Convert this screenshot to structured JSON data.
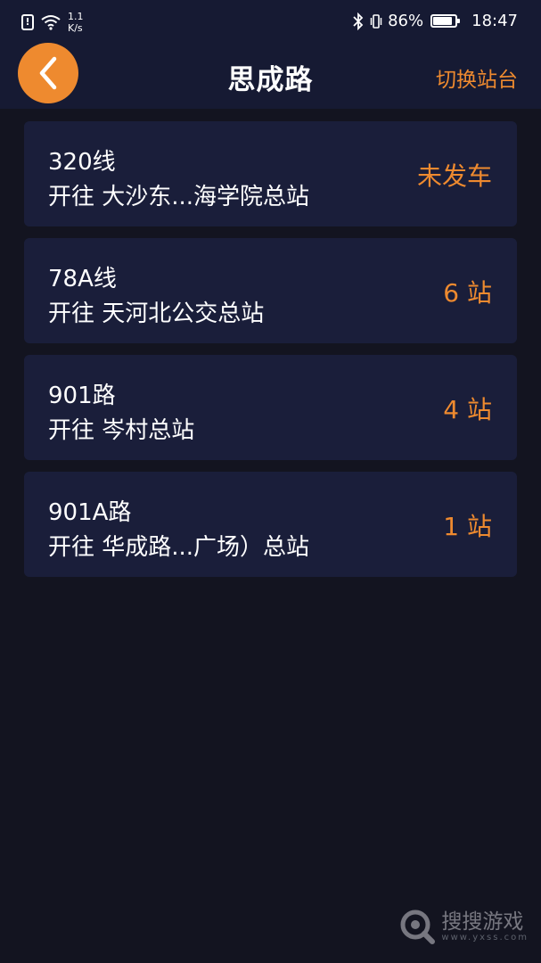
{
  "status_bar": {
    "net_speed_value": "1.1",
    "net_speed_unit": "K/s",
    "battery": "86%",
    "time": "18:47"
  },
  "header": {
    "title": "思成路",
    "switch_label": "切换站台"
  },
  "routes": [
    {
      "name": "320线",
      "dest": "开往 大沙东...海学院总站",
      "status": "未发车"
    },
    {
      "name": "78A线",
      "dest": "开往 天河北公交总站",
      "status": "6 站"
    },
    {
      "name": "901路",
      "dest": "开往 岑村总站",
      "status": "4 站"
    },
    {
      "name": "901A路",
      "dest": "开往 华成路...广场）总站",
      "status": "1 站"
    }
  ],
  "watermark": {
    "text": "搜搜游戏",
    "sub": "www.yxss.com"
  },
  "colors": {
    "accent": "#ee8a2f",
    "header_bg": "#161a33",
    "card_bg": "#1a1e3a",
    "page_bg": "#131420"
  },
  "icons": {
    "alert": "alert-icon",
    "wifi": "wifi-icon",
    "bluetooth": "bluetooth-icon",
    "vibrate": "vibrate-icon",
    "battery": "battery-icon",
    "back": "chevron-left-icon",
    "watermark_logo": "magnifier-logo-icon"
  }
}
